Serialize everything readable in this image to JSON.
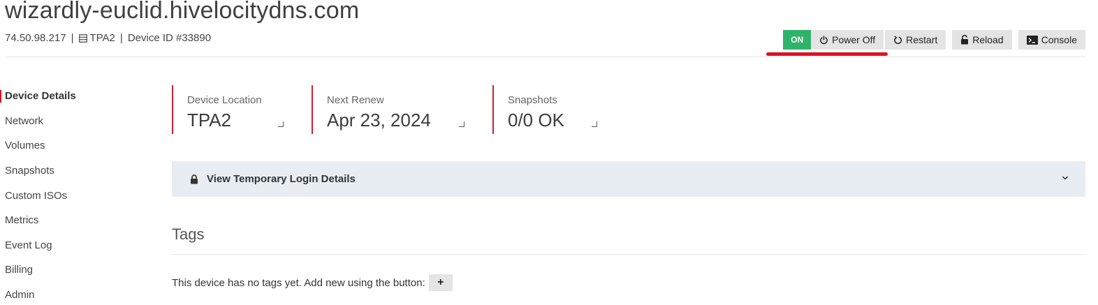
{
  "header": {
    "hostname": "wizardly-euclid.hivelocitydns.com",
    "ip": "74.50.98.217",
    "location": "TPA2",
    "device_id": "Device ID #33890",
    "separator": "|"
  },
  "actions": {
    "status": "ON",
    "power_off": "Power Off",
    "restart": "Restart",
    "reload": "Reload",
    "console": "Console",
    "status_color": "#2fb36b",
    "highlight_color": "#e01020"
  },
  "sidebar": {
    "items": [
      {
        "label": "Device Details",
        "active": true
      },
      {
        "label": "Network"
      },
      {
        "label": "Volumes"
      },
      {
        "label": "Snapshots"
      },
      {
        "label": "Custom ISOs"
      },
      {
        "label": "Metrics"
      },
      {
        "label": "Event Log"
      },
      {
        "label": "Billing"
      },
      {
        "label": "Admin"
      }
    ]
  },
  "stats": [
    {
      "label": "Device Location",
      "value": "TPA2"
    },
    {
      "label": "Next Renew",
      "value": "Apr 23, 2024"
    },
    {
      "label": "Snapshots",
      "value": "0/0 OK"
    }
  ],
  "login_panel": {
    "label": "View Temporary Login Details",
    "icon": "lock-icon"
  },
  "tags": {
    "title": "Tags",
    "empty_text": "This device has no tags yet. Add new using the button:",
    "add_label": "+"
  }
}
